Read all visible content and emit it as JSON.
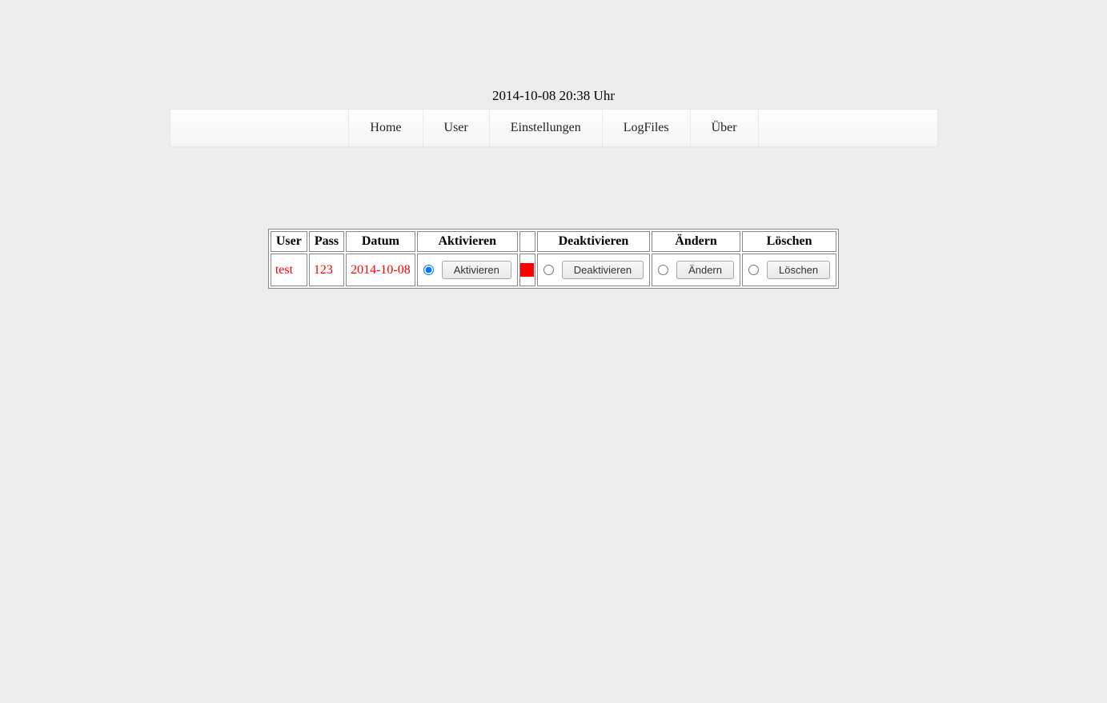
{
  "timestamp": "2014-10-08 20:38 Uhr",
  "nav": {
    "home": "Home",
    "user": "User",
    "settings": "Einstellungen",
    "logfiles": "LogFiles",
    "about": "Über"
  },
  "table": {
    "headers": {
      "user": "User",
      "pass": "Pass",
      "date": "Datum",
      "activate": "Aktivieren",
      "status": "",
      "deactivate": "Deaktivieren",
      "change": "Ändern",
      "delete": "Löschen"
    },
    "row": {
      "user": "test",
      "pass": "123",
      "date": "2014-10-08",
      "status_color": "#ff0000",
      "buttons": {
        "activate": "Aktivieren",
        "deactivate": "Deaktivieren",
        "change": "Ändern",
        "delete": "Löschen"
      }
    }
  }
}
